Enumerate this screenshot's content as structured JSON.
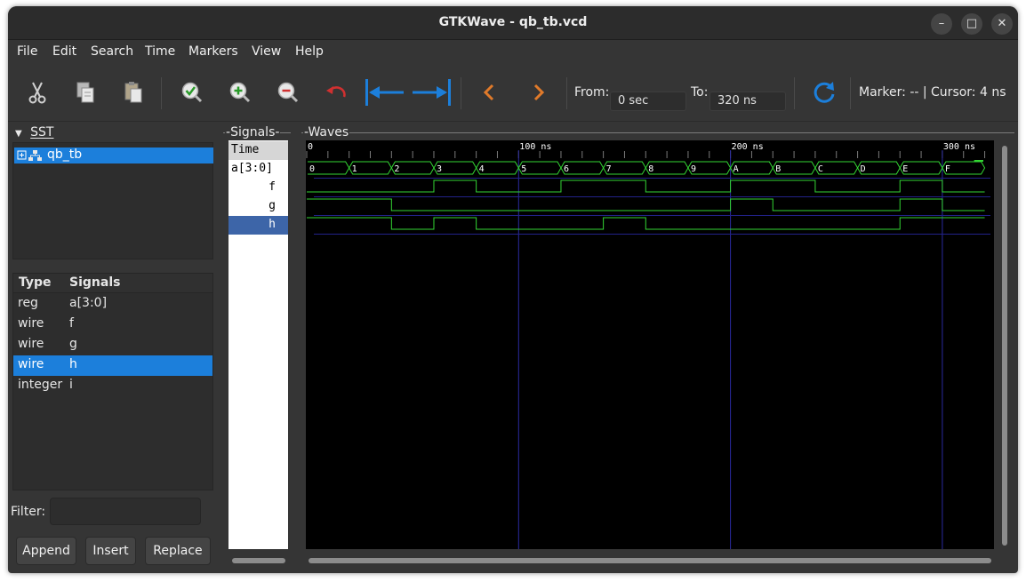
{
  "window": {
    "title": "GTKWave - qb_tb.vcd"
  },
  "menu": [
    "File",
    "Edit",
    "Search",
    "Time",
    "Markers",
    "View",
    "Help"
  ],
  "toolbar": {
    "icons": [
      "cut-icon",
      "copy-icon",
      "paste-icon",
      "zoom-fit-icon",
      "zoom-in-icon",
      "zoom-out-icon",
      "undo-icon",
      "to-start-icon",
      "to-end-icon",
      "prev-icon",
      "next-icon",
      "reload-icon"
    ],
    "from_label": "From:",
    "from_value": "0 sec",
    "to_label": "To:",
    "to_value": "320 ns",
    "marker_text": "Marker: -- | Cursor: 4 ns"
  },
  "sst": {
    "title": "SST",
    "tree": [
      {
        "label": "qb_tb",
        "selected": true
      }
    ]
  },
  "signal_table": {
    "headers": [
      "Type",
      "Signals"
    ],
    "rows": [
      {
        "type": "reg",
        "name": "a[3:0]",
        "selected": false
      },
      {
        "type": "wire",
        "name": "f",
        "selected": false
      },
      {
        "type": "wire",
        "name": "g",
        "selected": false
      },
      {
        "type": "wire",
        "name": "h",
        "selected": true
      },
      {
        "type": "integer",
        "name": "i",
        "selected": false
      }
    ]
  },
  "filter": {
    "label": "Filter:",
    "value": ""
  },
  "buttons": {
    "append": "Append",
    "insert": "Insert",
    "replace": "Replace"
  },
  "signals_panel": {
    "title": "Signals",
    "rows": [
      {
        "name": "Time",
        "kind": "time"
      },
      {
        "name": "a[3:0]",
        "kind": "bus"
      },
      {
        "name": "f",
        "kind": "wire"
      },
      {
        "name": "g",
        "kind": "wire"
      },
      {
        "name": "h",
        "kind": "wire",
        "selected": true
      }
    ]
  },
  "waves_panel": {
    "title": "Waves",
    "time_range_ns": [
      0,
      320
    ],
    "major_ticks": [
      {
        "t": 0,
        "label": "0"
      },
      {
        "t": 100,
        "label": "100 ns"
      },
      {
        "t": 200,
        "label": "200 ns"
      },
      {
        "t": 300,
        "label": "300 ns"
      }
    ],
    "colors": {
      "wave": "#33d633",
      "grid": "#2a2aa0",
      "tick_text": "#ffffff",
      "background": "#000000"
    },
    "bus_a": {
      "period_ns": 20,
      "values": [
        "0",
        "1",
        "2",
        "3",
        "4",
        "5",
        "6",
        "7",
        "8",
        "9",
        "A",
        "B",
        "C",
        "D",
        "E",
        "F"
      ]
    },
    "signals": {
      "f": [
        0,
        0,
        0,
        1,
        0,
        0,
        1,
        1,
        0,
        0,
        1,
        1,
        0,
        0,
        1,
        0
      ],
      "g": [
        1,
        1,
        0,
        0,
        0,
        0,
        0,
        0,
        0,
        0,
        1,
        0,
        0,
        0,
        1,
        0
      ],
      "h": [
        1,
        1,
        0,
        1,
        0,
        0,
        0,
        1,
        0,
        0,
        0,
        0,
        0,
        0,
        1,
        1
      ]
    }
  }
}
